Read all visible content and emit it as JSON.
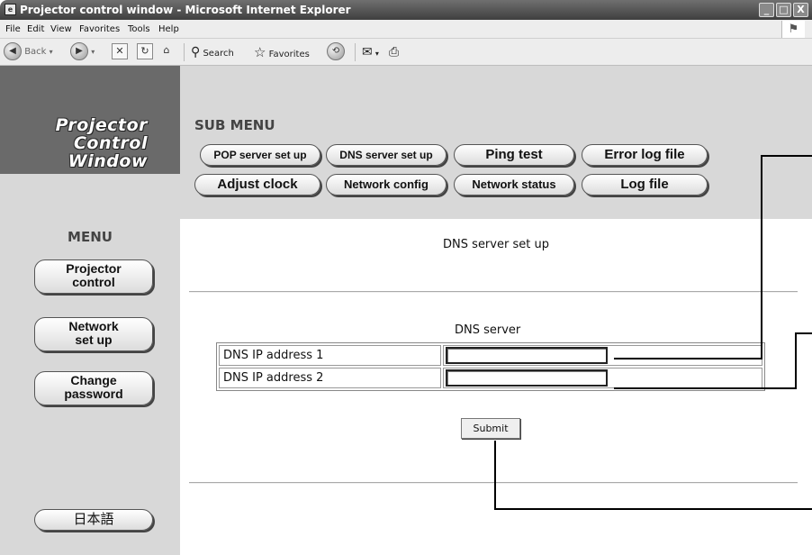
{
  "window": {
    "title": "Projector control window - Microsoft Internet Explorer",
    "controls": [
      "_",
      "□",
      "X"
    ]
  },
  "menubar": [
    "File",
    "Edit",
    "View",
    "Favorites",
    "Tools",
    "Help"
  ],
  "toolbar": {
    "back": "Back",
    "search": "Search",
    "favorites": "Favorites"
  },
  "logo": {
    "line1": "Projector",
    "line2": "Control",
    "line3": "Window"
  },
  "submenu": {
    "title": "SUB MENU",
    "buttons": [
      "POP server set up",
      "DNS server set up",
      "Ping test",
      "Error log file",
      "Adjust clock",
      "Network config",
      "Network status",
      "Log file"
    ]
  },
  "menu": {
    "title": "MENU",
    "items": [
      {
        "line1": "Projector",
        "line2": "control"
      },
      {
        "line1": "Network",
        "line2": "set up"
      },
      {
        "line1": "Change",
        "line2": "password"
      }
    ],
    "language": "日本語"
  },
  "page": {
    "title": "DNS server set up",
    "section_label": "DNS server",
    "rows": [
      {
        "label": "DNS IP address 1",
        "value": ""
      },
      {
        "label": "DNS IP address 2",
        "value": ""
      }
    ],
    "submit": "Submit"
  }
}
